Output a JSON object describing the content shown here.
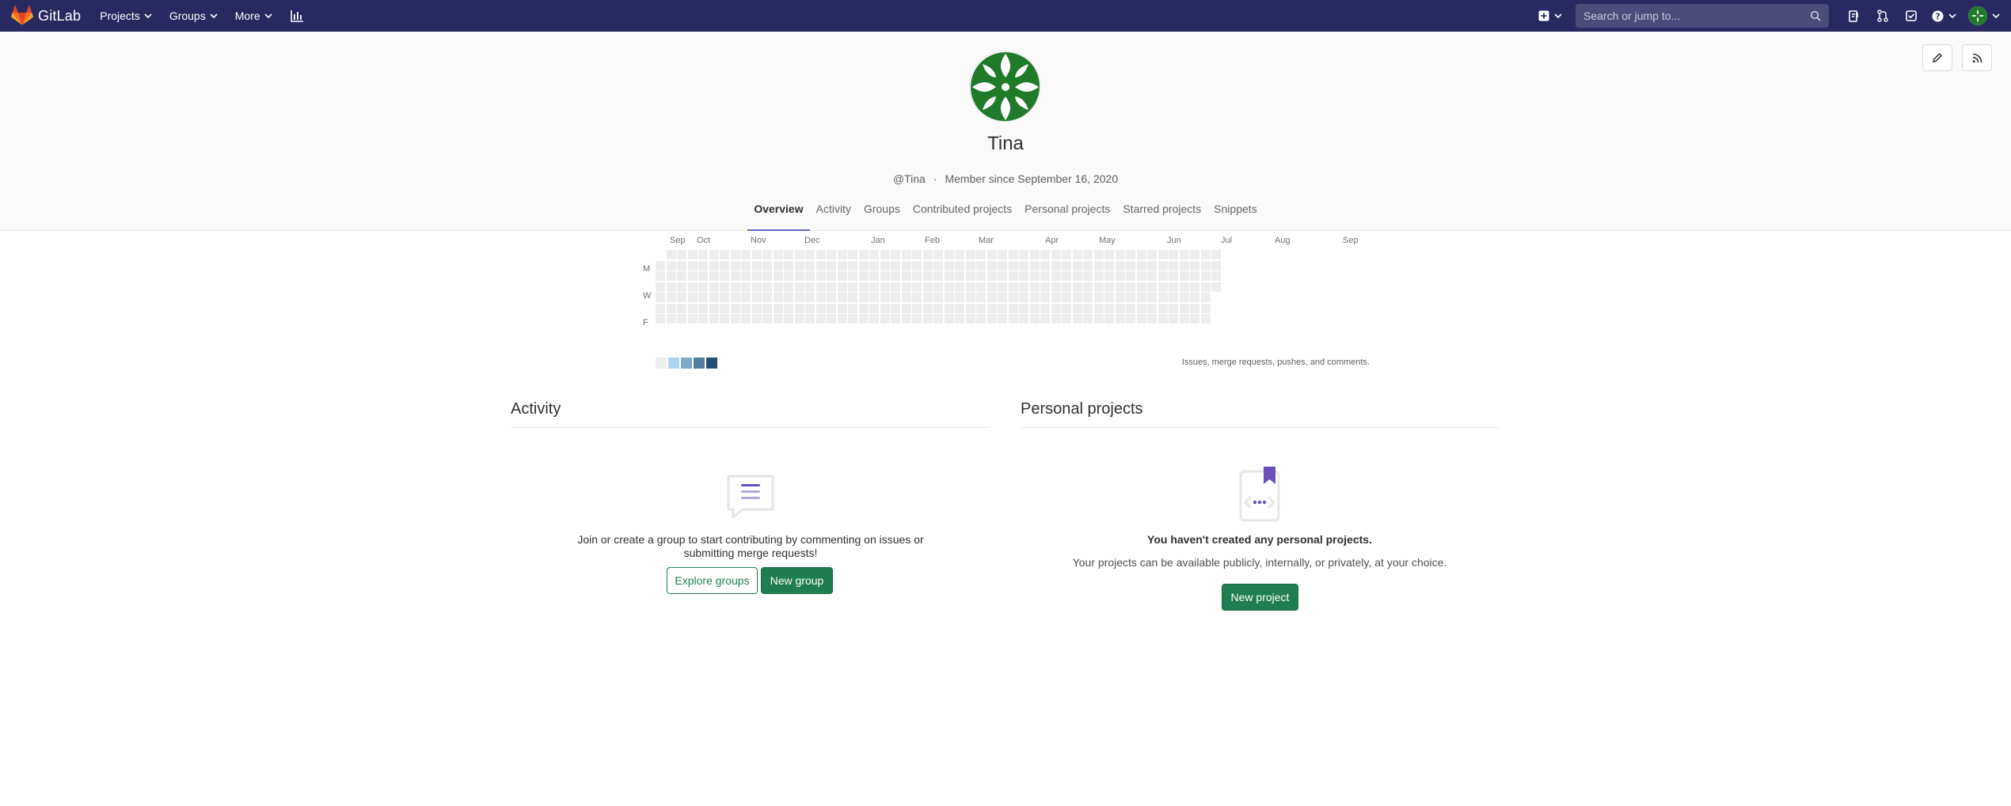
{
  "navbar": {
    "brand": "GitLab",
    "menu": [
      {
        "label": "Projects",
        "caret": "chevron-down-icon"
      },
      {
        "label": "Groups",
        "caret": "chevron-down-icon"
      },
      {
        "label": "More",
        "caret": "chevron-down-icon"
      }
    ],
    "search_placeholder": "Search or jump to...",
    "icons": [
      "plus-square-icon",
      "todo-list-icon",
      "merge-request-icon",
      "issues-icon",
      "help-icon",
      "user-avatar"
    ]
  },
  "profile": {
    "name": "Tina",
    "username": "@Tina",
    "member_since": "Member since September 16, 2020",
    "tabs": [
      "Overview",
      "Activity",
      "Groups",
      "Contributed projects",
      "Personal projects",
      "Starred projects",
      "Snippets"
    ],
    "active_tab": "Overview"
  },
  "calendar": {
    "months": [
      "Sep",
      "Oct",
      "Nov",
      "Dec",
      "Jan",
      "Feb",
      "Mar",
      "Apr",
      "May",
      "Jun",
      "Jul",
      "Aug",
      "Sep"
    ],
    "days": [
      "M",
      "W",
      "F"
    ],
    "legend_colors": [
      "#ededed",
      "#acd5f2",
      "#7fa8c9",
      "#527ba0",
      "#254e77"
    ],
    "note": "Issues, merge requests, pushes, and comments."
  },
  "activity": {
    "title": "Activity",
    "empty_text": "Join or create a group to start contributing by commenting on issues or submitting merge requests!",
    "explore_button": "Explore groups",
    "new_group_button": "New group"
  },
  "personal_projects": {
    "title": "Personal projects",
    "empty_title": "You haven't created any personal projects.",
    "empty_subtitle": "Your projects can be available publicly, internally, or privately, at your choice.",
    "new_project_button": "New project"
  }
}
